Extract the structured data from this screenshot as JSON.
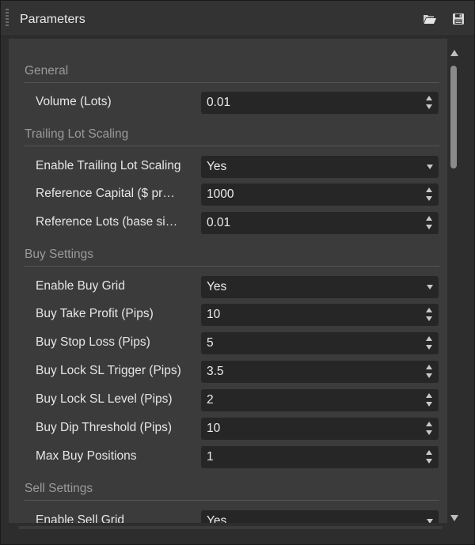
{
  "panel": {
    "title": "Parameters"
  },
  "sections": {
    "general": "General",
    "trailing": "Trailing Lot Scaling",
    "buy": "Buy Settings",
    "sell": "Sell Settings"
  },
  "params": [
    {
      "label": "Volume (Lots)",
      "value": "0.01",
      "kind": "number"
    },
    {
      "label": "Enable Trailing Lot Scaling",
      "value": "Yes",
      "kind": "select"
    },
    {
      "label": "Reference Capital ($ pr…",
      "value": "1000",
      "kind": "number"
    },
    {
      "label": "Reference Lots (base si…",
      "value": "0.01",
      "kind": "number"
    },
    {
      "label": "Enable Buy Grid",
      "value": "Yes",
      "kind": "select"
    },
    {
      "label": "Buy Take Profit (Pips)",
      "value": "10",
      "kind": "number"
    },
    {
      "label": "Buy Stop Loss (Pips)",
      "value": "5",
      "kind": "number"
    },
    {
      "label": "Buy Lock SL Trigger (Pips)",
      "value": "3.5",
      "kind": "number"
    },
    {
      "label": "Buy Lock SL Level (Pips)",
      "value": "2",
      "kind": "number"
    },
    {
      "label": "Buy Dip Threshold (Pips)",
      "value": "10",
      "kind": "number"
    },
    {
      "label": "Max Buy Positions",
      "value": "1",
      "kind": "number"
    },
    {
      "label": "Enable Sell Grid",
      "value": "Yes",
      "kind": "select"
    }
  ],
  "icons": {
    "open": "folder-open-icon",
    "save": "floppy-disk-icon"
  },
  "colors": {
    "background": "#2d2d2d",
    "panel": "#3b3b3b",
    "field": "#262626",
    "section_text": "#9a9a9a",
    "text": "#e6e6e6"
  }
}
